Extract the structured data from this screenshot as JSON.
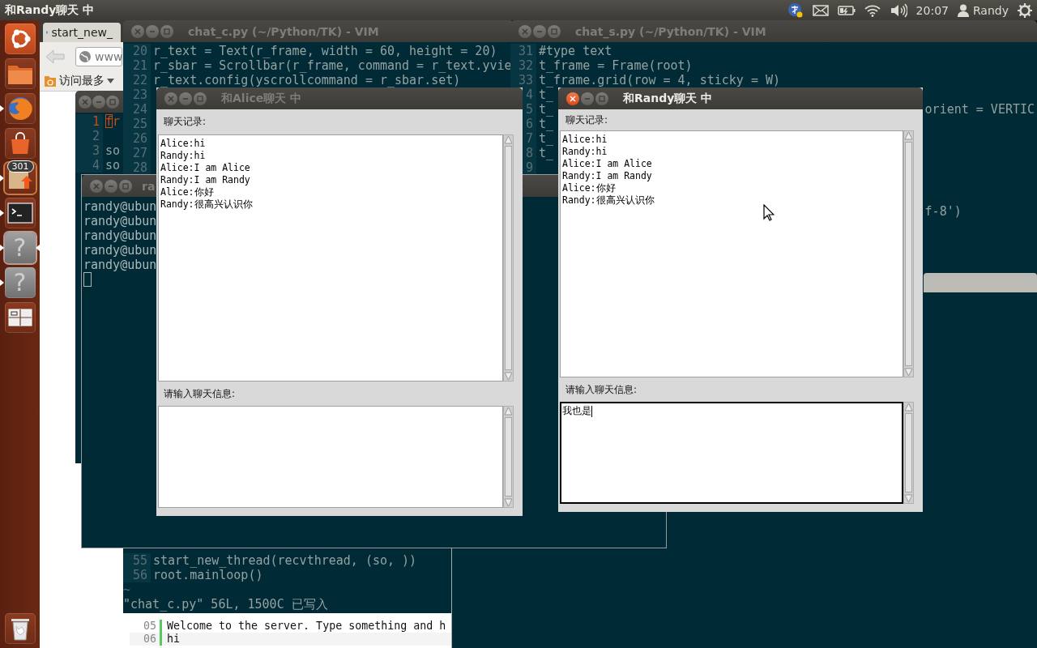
{
  "top_panel": {
    "title": "和Randy聊天 中",
    "clock": "20:07",
    "user": "Randy"
  },
  "launcher": {
    "items": [
      {
        "kind": "ubuntu",
        "running": false,
        "focused": false
      },
      {
        "kind": "files",
        "running": false,
        "focused": false
      },
      {
        "kind": "firefox",
        "running": true,
        "focused": false
      },
      {
        "kind": "shop",
        "running": false,
        "focused": false
      },
      {
        "kind": "update",
        "running": true,
        "focused": false,
        "badge": "301"
      },
      {
        "kind": "terminal",
        "running": true,
        "focused": false
      },
      {
        "kind": "unknown",
        "glyph": "?",
        "running": true,
        "focused": true
      },
      {
        "kind": "unknown",
        "glyph": "?",
        "running": true,
        "focused": false
      },
      {
        "kind": "workspaces",
        "running": false,
        "focused": false
      }
    ]
  },
  "browser": {
    "tab": "start_new_",
    "url": "www",
    "bookmark": "访问最多",
    "lines": [
      {
        "number": "05",
        "text": "Welcome to the server. Type something and h"
      },
      {
        "number": "06",
        "text": "hi"
      }
    ]
  },
  "small_vim": {
    "lines": [
      {
        "number": "1",
        "text": "fr",
        "cursor": true
      },
      {
        "number": "2",
        "cursor": false
      },
      {
        "number": "3",
        "text": "so",
        "cursor": false
      },
      {
        "number": "4",
        "text": "so",
        "cursor": false
      }
    ]
  },
  "client_vim": {
    "title": "chat_c.py (~/Python/TK) - VIM",
    "lines": [
      {
        "number": "20",
        "text": "r_text = Text(r_frame, width = 60, height = 20)"
      },
      {
        "number": "21",
        "text": "r_sbar = Scrollbar(r_frame, command = r_text.yvie"
      },
      {
        "number": "22",
        "text": "r_text.config(yscrollcommand = r_sbar.set)"
      },
      {
        "number": "23"
      },
      {
        "number": "24"
      },
      {
        "number": "25"
      },
      {
        "number": "26"
      },
      {
        "number": "27"
      },
      {
        "number": "28"
      }
    ],
    "bottom_lines": [
      {
        "number": "55",
        "text": "start_new_thread(recvthread, (so, ))"
      },
      {
        "number": "56",
        "text": "root.mainloop()"
      }
    ],
    "filler": "~",
    "status": "\"chat_c.py\" 56L, 1500C 已写入"
  },
  "server_vim": {
    "title": "chat_s.py (~/Python/TK) - VIM",
    "lines": [
      {
        "number": "31",
        "text": "#type text"
      },
      {
        "number": "32",
        "text": "t_frame = Frame(root)"
      },
      {
        "number": "33",
        "text": "t_frame.grid(row = 4, sticky = W)"
      },
      {
        "number": "4",
        "text": "t_"
      },
      {
        "number": "5",
        "text": "t_",
        "tail": "orient = VERTIC"
      },
      {
        "number": "6",
        "text": "t_"
      },
      {
        "number": "7",
        "text": "t_"
      },
      {
        "number": "8",
        "text": "t_"
      },
      {
        "number": "9"
      }
    ],
    "fragment": "f-8')"
  },
  "terminal": {
    "title": "ra",
    "lines": [
      "randy@ubun",
      "randy@ubun",
      "randy@ubun",
      "randy@ubun",
      "randy@ubun"
    ],
    "cursor": true
  },
  "chats": [
    {
      "title": "和Alice聊天 中",
      "active": false,
      "history_label": "聊天记录:",
      "messages": [
        "Alice:hi",
        "Randy:hi",
        "Alice:I am Alice",
        "Randy:I am Randy",
        "Alice:你好",
        "Randy:很高兴认识你"
      ],
      "input_label": "请输入聊天信息:",
      "focused": false
    },
    {
      "title": "和Randy聊天 中",
      "active": true,
      "history_label": "聊天记录:",
      "messages": [
        "Alice:hi",
        "Randy:hi",
        "Alice:I am Alice",
        "Randy:I am Randy",
        "Alice:你好",
        "Randy:很高兴认识你"
      ],
      "input_label": "请输入聊天信息:",
      "input": "我也是",
      "focused": true
    }
  ]
}
